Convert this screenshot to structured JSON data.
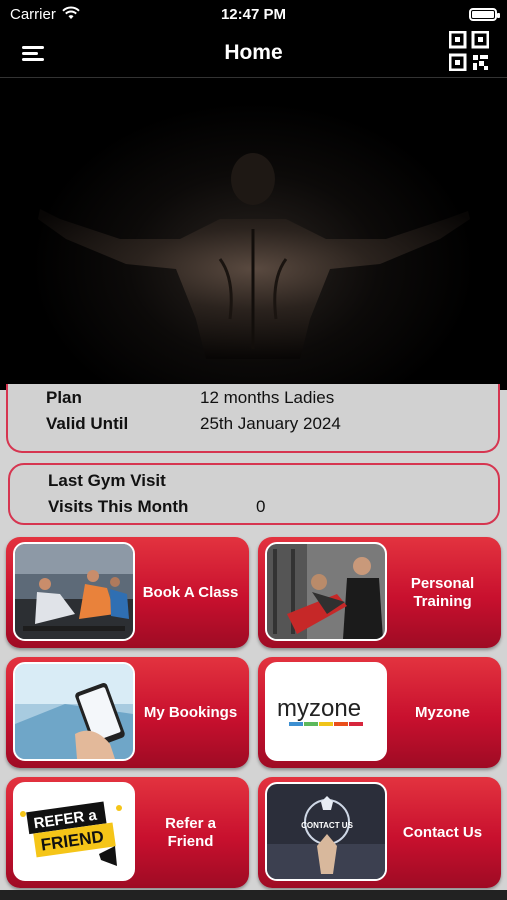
{
  "status_bar": {
    "carrier": "Carrier",
    "time": "12:47 PM"
  },
  "nav": {
    "title": "Home",
    "menu_icon": "hamburger-menu-icon",
    "qr_icon": "qr-code-icon"
  },
  "membership": {
    "plan_label": "Plan",
    "plan_value": "12 months Ladies",
    "valid_label": "Valid Until",
    "valid_value": "25th January 2024"
  },
  "visits": {
    "last_visit_label": "Last Gym Visit",
    "last_visit_value": "",
    "month_label": "Visits This Month",
    "month_value": "0"
  },
  "tiles": [
    {
      "label": "Book A Class"
    },
    {
      "label": "Personal\nTraining"
    },
    {
      "label": "My Bookings"
    },
    {
      "label": "Myzone"
    },
    {
      "label": "Refer a\nFriend"
    },
    {
      "label": "Contact Us"
    }
  ],
  "images": {
    "myzone_logo_text": "myzone",
    "refer_badge_line1": "REFER a",
    "refer_badge_line2": "FRIEND",
    "contact_badge": "CONTACT US"
  },
  "colors": {
    "accent": "#c8102e",
    "background": "#d3d3d3",
    "header": "#000000"
  }
}
